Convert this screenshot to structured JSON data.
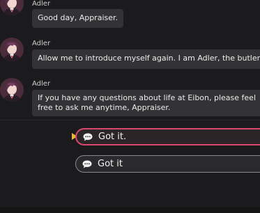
{
  "colors": {
    "background": "#1b1b1d",
    "bubble": "#333336",
    "selected_border": "#d9476f",
    "pointer": "#e8b72c"
  },
  "messages": [
    {
      "speaker": "Adler",
      "text": "Good day, Appraiser."
    },
    {
      "speaker": "Adler",
      "text": "Allow me to introduce myself again. I am Adler, the butler of Eibon"
    },
    {
      "speaker": "Adler",
      "text": "If you have any questions about life at Eibon, please feel free to ask me anytime, Appraiser."
    }
  ],
  "choices": [
    {
      "label": "Got it.",
      "icon": "chat-bubble-icon",
      "selected": true
    },
    {
      "label": "Got it",
      "icon": "chat-bubble-icon",
      "selected": false
    }
  ]
}
